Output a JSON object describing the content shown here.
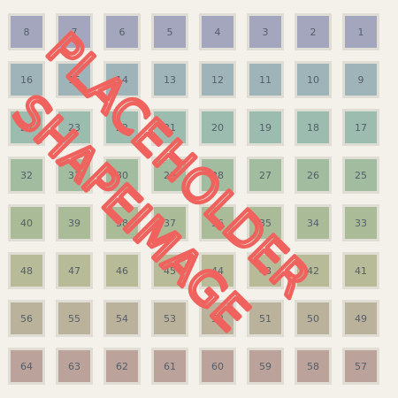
{
  "tiles": [
    {
      "label": "8",
      "color": "#a3a6bd"
    },
    {
      "label": "7",
      "color": "#a3a6bd"
    },
    {
      "label": "6",
      "color": "#a3a6bd"
    },
    {
      "label": "5",
      "color": "#a3a6bd"
    },
    {
      "label": "4",
      "color": "#a3a6bd"
    },
    {
      "label": "3",
      "color": "#a3a6bd"
    },
    {
      "label": "2",
      "color": "#a3a6bd"
    },
    {
      "label": "1",
      "color": "#a3a6bd"
    },
    {
      "label": "16",
      "color": "#9eb4b8"
    },
    {
      "label": "15",
      "color": "#9eb4b8"
    },
    {
      "label": "14",
      "color": "#9eb4b8"
    },
    {
      "label": "13",
      "color": "#9eb4b8"
    },
    {
      "label": "12",
      "color": "#9eb4b8"
    },
    {
      "label": "11",
      "color": "#9eb4b8"
    },
    {
      "label": "10",
      "color": "#9eb4b8"
    },
    {
      "label": "9",
      "color": "#9eb4b8"
    },
    {
      "label": "24",
      "color": "#9cbcb0"
    },
    {
      "label": "23",
      "color": "#9cbcb0"
    },
    {
      "label": "22",
      "color": "#9cbcb0"
    },
    {
      "label": "21",
      "color": "#9cbcb0"
    },
    {
      "label": "20",
      "color": "#9cbcb0"
    },
    {
      "label": "19",
      "color": "#9cbcb0"
    },
    {
      "label": "18",
      "color": "#9cbcb0"
    },
    {
      "label": "17",
      "color": "#9cbcb0"
    },
    {
      "label": "32",
      "color": "#a1bc9e"
    },
    {
      "label": "31",
      "color": "#a1bc9e"
    },
    {
      "label": "30",
      "color": "#a1bc9e"
    },
    {
      "label": "29",
      "color": "#a1bc9e"
    },
    {
      "label": "28",
      "color": "#a1bc9e"
    },
    {
      "label": "27",
      "color": "#a1bc9e"
    },
    {
      "label": "26",
      "color": "#a1bc9e"
    },
    {
      "label": "25",
      "color": "#a1bc9e"
    },
    {
      "label": "40",
      "color": "#aabc97"
    },
    {
      "label": "39",
      "color": "#aabc97"
    },
    {
      "label": "38",
      "color": "#aabc97"
    },
    {
      "label": "37",
      "color": "#aabc97"
    },
    {
      "label": "36",
      "color": "#aabc97"
    },
    {
      "label": "35",
      "color": "#aabc97"
    },
    {
      "label": "34",
      "color": "#aabc97"
    },
    {
      "label": "33",
      "color": "#aabc97"
    },
    {
      "label": "48",
      "color": "#b7bb98"
    },
    {
      "label": "47",
      "color": "#b7bb98"
    },
    {
      "label": "46",
      "color": "#b7bb98"
    },
    {
      "label": "45",
      "color": "#b7bb98"
    },
    {
      "label": "44",
      "color": "#b7bb98"
    },
    {
      "label": "43",
      "color": "#b7bb98"
    },
    {
      "label": "42",
      "color": "#b7bb98"
    },
    {
      "label": "41",
      "color": "#b7bb98"
    },
    {
      "label": "56",
      "color": "#bbb29b"
    },
    {
      "label": "55",
      "color": "#bbb29b"
    },
    {
      "label": "54",
      "color": "#bbb29b"
    },
    {
      "label": "53",
      "color": "#bbb29b"
    },
    {
      "label": "52",
      "color": "#bbb29b"
    },
    {
      "label": "51",
      "color": "#bbb29b"
    },
    {
      "label": "50",
      "color": "#bbb29b"
    },
    {
      "label": "49",
      "color": "#bbb29b"
    },
    {
      "label": "64",
      "color": "#bba39b"
    },
    {
      "label": "63",
      "color": "#bba39b"
    },
    {
      "label": "62",
      "color": "#bba39b"
    },
    {
      "label": "61",
      "color": "#bba39b"
    },
    {
      "label": "60",
      "color": "#bba39b"
    },
    {
      "label": "59",
      "color": "#bba39b"
    },
    {
      "label": "58",
      "color": "#bba39b"
    },
    {
      "label": "57",
      "color": "#bba39b"
    }
  ],
  "watermark": {
    "line1": "PLACEHOLDER",
    "line2": "SHAPEIMAGE",
    "color": "#f0625d"
  }
}
